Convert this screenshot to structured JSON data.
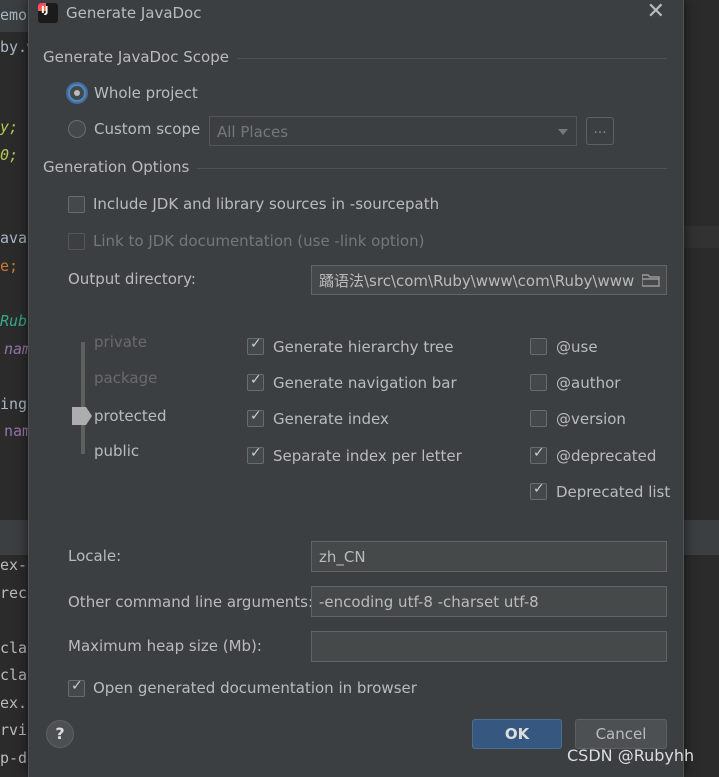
{
  "editor_bg": {
    "lines": [
      {
        "text": "emo",
        "color": "#a9b7c6"
      },
      {
        "text": "by.w",
        "color": "#a9b7c6"
      },
      {
        "text": "y;",
        "color": "#b7c754"
      },
      {
        "text": "0;",
        "color": "#b7c754"
      },
      {
        "text": "ava",
        "color": "#a9b7c6"
      },
      {
        "text": "e;",
        "color": "#cc7832"
      },
      {
        "text": "Rub",
        "color": "#3aa88a"
      },
      {
        "text": "nam",
        "color": "#9876aa"
      },
      {
        "text": "ing",
        "color": "#a9b7c6"
      },
      {
        "text": "nam",
        "color": "#9876aa"
      },
      {
        "text": "ex-",
        "color": "#a9b7c6"
      },
      {
        "text": "rec",
        "color": "#a9b7c6"
      },
      {
        "text": "cla",
        "color": "#a9b7c6"
      },
      {
        "text": "cla",
        "color": "#a9b7c6"
      },
      {
        "text": "ex.",
        "color": "#a9b7c6"
      },
      {
        "text": "rvi",
        "color": "#a9b7c6"
      },
      {
        "text": "p-dove..r..",
        "color": "#a9b7c6"
      }
    ]
  },
  "dialog": {
    "title": "Generate JavaDoc",
    "scope": {
      "group_title": "Generate JavaDoc Scope",
      "whole_project": "Whole project",
      "custom_scope": "Custom scope",
      "scope_combo_value": "All Places",
      "browse_label": "..."
    },
    "options": {
      "group_title": "Generation Options",
      "include_jdk": "Include JDK and library sources in -sourcepath",
      "link_jdk": "Link to JDK documentation (use -link option)",
      "output_dir_label": "Output directory:",
      "output_dir_value": "蹫语法\\src\\com\\Ruby\\www\\com\\Ruby\\www"
    },
    "visibility": {
      "levels": [
        "private",
        "package",
        "protected",
        "public"
      ],
      "selected": "protected"
    },
    "generate": {
      "hierarchy": "Generate hierarchy tree",
      "navigation": "Generate navigation bar",
      "index": "Generate index",
      "separate_index": "Separate index per letter"
    },
    "tags": {
      "use": "@use",
      "author": "@author",
      "version": "@version",
      "deprecated": "@deprecated",
      "deprecated_list": "Deprecated list"
    },
    "locale_label": "Locale:",
    "locale_value": "zh_CN",
    "args_label": "Other command line arguments:",
    "args_value": "-encoding utf-8 -charset utf-8",
    "heap_label": "Maximum heap size (Mb):",
    "heap_value": "",
    "open_browser": "Open generated documentation in browser",
    "ok": "OK",
    "cancel": "Cancel",
    "help": "?"
  },
  "watermark": "CSDN @Rubyhh",
  "colors": {
    "dialog_bg": "#3c3f41",
    "editor_bg": "#2b2b2b",
    "ok_button": "#365880",
    "text": "#bbbbbb",
    "focus_ring": "#4a88c7"
  }
}
